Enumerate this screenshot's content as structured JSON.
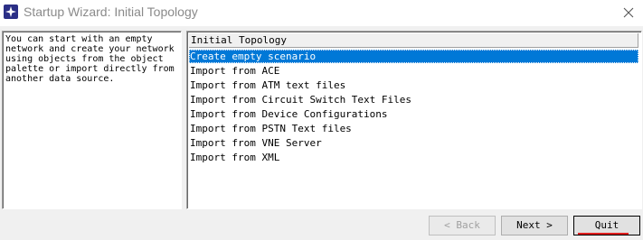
{
  "window": {
    "title": "Startup Wizard: Initial Topology",
    "icon": "star-app-icon",
    "close_icon": "close-icon"
  },
  "description": {
    "text": "You can start with an empty\nnetwork and create your network\nusing objects from the object\npalette or import directly from\nanother data source."
  },
  "topology_list": {
    "header": "Initial Topology",
    "selected_index": 0,
    "items": [
      {
        "label": "Create empty scenario"
      },
      {
        "label": "Import from ACE"
      },
      {
        "label": "Import from ATM text files"
      },
      {
        "label": "Import from Circuit Switch Text Files"
      },
      {
        "label": "Import from Device Configurations"
      },
      {
        "label": "Import from PSTN Text files"
      },
      {
        "label": "Import from VNE Server"
      },
      {
        "label": "Import from XML"
      }
    ]
  },
  "buttons": {
    "back": {
      "label": "< Back",
      "enabled": false
    },
    "next": {
      "label": "Next >",
      "enabled": true
    },
    "quit": {
      "label": "Quit",
      "enabled": true
    }
  },
  "colors": {
    "selection": "#0078d7",
    "annotation_underline": "#e02020"
  }
}
